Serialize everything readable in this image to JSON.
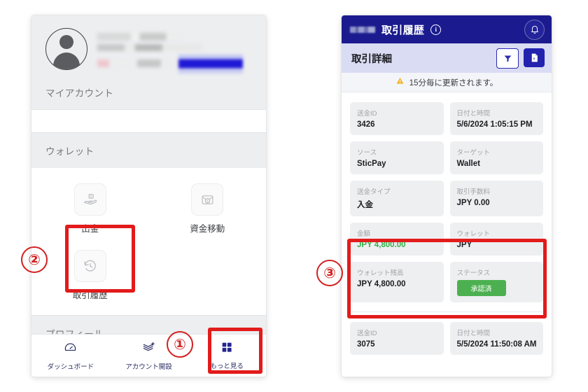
{
  "left_phone": {
    "profile": {
      "name_redacted": true,
      "account_label_redacted": true,
      "section_label": "マイアカウント"
    },
    "wallet": {
      "section_label": "ウォレット",
      "tiles": [
        {
          "label": "出金",
          "icon": "hand-money-icon"
        },
        {
          "label": "資金移動",
          "icon": "envelope-money-icon"
        },
        {
          "label": "取引履歴",
          "icon": "clock-rewind-icon"
        }
      ]
    },
    "profile_section": {
      "label": "プロフィール"
    },
    "bottom_nav": [
      {
        "label": "ダッシュボード",
        "icon": "gauge-icon"
      },
      {
        "label": "アカウント開設",
        "icon": "layers-plus-icon"
      },
      {
        "label": "もっと見る",
        "icon": "grid-squares-icon"
      }
    ]
  },
  "right_phone": {
    "header": {
      "title": "取引履歴",
      "info_icon": "info-icon",
      "bell_icon": "bell-icon"
    },
    "subheader": {
      "title": "取引詳細",
      "filter_icon": "funnel-icon",
      "export_icon": "excel-file-icon"
    },
    "alert": {
      "icon": "warning-triangle-icon",
      "text": "15分毎に更新されます。"
    },
    "transactions": [
      {
        "fields": [
          {
            "label": "送金ID",
            "value": "3426"
          },
          {
            "label": "日付と時間",
            "value": "5/6/2024 1:05:15 PM"
          },
          {
            "label": "ソース",
            "value": "SticPay"
          },
          {
            "label": "ターゲット",
            "value": "Wallet"
          },
          {
            "label": "送金タイプ",
            "value": "入金"
          },
          {
            "label": "取引手数料",
            "value": "JPY 0.00"
          },
          {
            "label": "金額",
            "value": "JPY 4,800.00"
          },
          {
            "label": "ウォレット",
            "value": "JPY"
          },
          {
            "label": "ウォレット残高",
            "value": "JPY 4,800.00"
          },
          {
            "label": "ステータス",
            "value": "承認済"
          }
        ]
      },
      {
        "fields": [
          {
            "label": "送金ID",
            "value": "3075"
          },
          {
            "label": "日付と時間",
            "value": "5/5/2024 11:50:08 AM"
          }
        ]
      }
    ]
  },
  "annotations": [
    {
      "number": "①",
      "target": "もっと見る"
    },
    {
      "number": "②",
      "target": "取引履歴"
    },
    {
      "number": "③",
      "target": "金額ブロック"
    }
  ],
  "colors": {
    "header_blue": "#1b1b8f",
    "subheader_blue": "#d9dcf3",
    "accent_blue": "#2222ae",
    "annotation_red": "#e21b1b",
    "status_green": "#4cb050",
    "amount_green": "#33b24b"
  }
}
